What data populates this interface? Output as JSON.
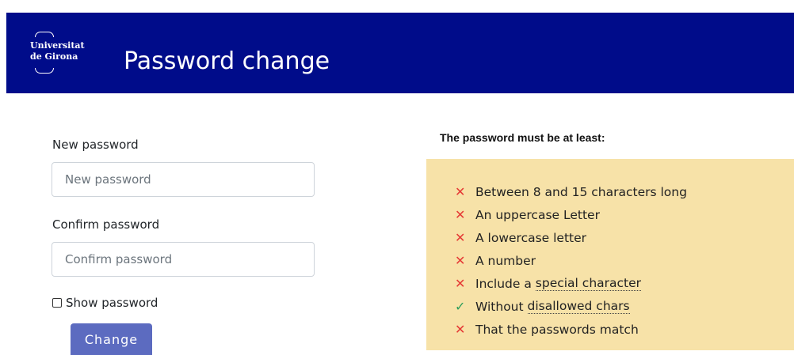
{
  "header": {
    "logo_line1": "Universitat",
    "logo_line2": "de Girona",
    "title": "Password change",
    "background_color": "#000c8a"
  },
  "form": {
    "new_password": {
      "label": "New password",
      "placeholder": "New password",
      "value": ""
    },
    "confirm_password": {
      "label": "Confirm password",
      "placeholder": "Confirm password",
      "value": ""
    },
    "show_password": {
      "label": "Show password",
      "checked": false
    },
    "submit_label": "Change"
  },
  "requirements": {
    "title": "The password must be at least:",
    "fail_icon": "cross-icon",
    "ok_icon": "check-icon",
    "items": [
      {
        "pre": "Between 8 and 15 characters long",
        "link": "",
        "status": "fail"
      },
      {
        "pre": "An uppercase Letter",
        "link": "",
        "status": "fail"
      },
      {
        "pre": "A lowercase letter",
        "link": "",
        "status": "fail"
      },
      {
        "pre": "A number",
        "link": "",
        "status": "fail"
      },
      {
        "pre": "Include a ",
        "link": "special character",
        "status": "fail"
      },
      {
        "pre": "Without ",
        "link": "disallowed chars",
        "status": "ok"
      },
      {
        "pre": "That the passwords match",
        "link": "",
        "status": "fail"
      }
    ]
  }
}
